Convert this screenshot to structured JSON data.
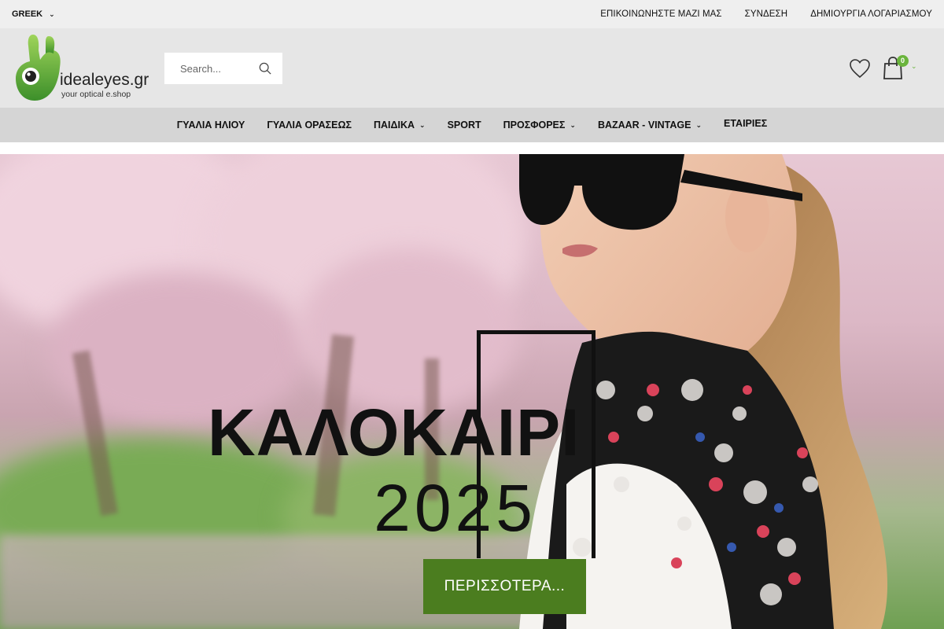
{
  "topbar": {
    "language": "GREEK",
    "links": [
      "ΕΠΙΚΟΙΝΩΝΗΣΤΕ ΜΑΖΙ ΜΑΣ",
      "ΣΥΝΔΕΣΗ",
      "ΔΗΜΙΟΥΡΓΙΑ ΛΟΓΑΡΙΑΣΜΟΥ"
    ]
  },
  "header": {
    "logo_text": "idealeyes.gr",
    "logo_tagline": "your optical e.shop",
    "search_placeholder": "Search...",
    "cart_count": "0"
  },
  "nav": {
    "items": [
      {
        "label": "ΓΥΑΛΙΑ ΗΛΙΟΥ",
        "has_dropdown": false
      },
      {
        "label": "ΓΥΑΛΙΑ ΟΡΑΣΕΩΣ",
        "has_dropdown": false
      },
      {
        "label": "ΠΑΙΔΙΚΑ",
        "has_dropdown": true
      },
      {
        "label": "SPORT",
        "has_dropdown": false
      },
      {
        "label": "ΠΡΟΣΦΟΡΕΣ",
        "has_dropdown": true
      },
      {
        "label": "BAZAAR - VINTAGE",
        "has_dropdown": true
      },
      {
        "label": "ΕΤΑΙΡΙΕΣ",
        "has_dropdown": false
      }
    ]
  },
  "hero": {
    "title": "ΚΑΛΟΚΑΙΡΙ",
    "year": "2025",
    "cta_label": "ΠΕΡΙΣΣΟΤΕΡΑ..."
  },
  "colors": {
    "accent_green": "#6ab43c",
    "cta_green": "#4b7d1f",
    "topbar_bg": "#efefef",
    "header_bg": "#e6e6e6",
    "nav_bg": "#d5d5d5"
  },
  "icons": [
    "chevron-down-icon",
    "search-icon",
    "heart-icon",
    "shopping-bag-icon"
  ]
}
